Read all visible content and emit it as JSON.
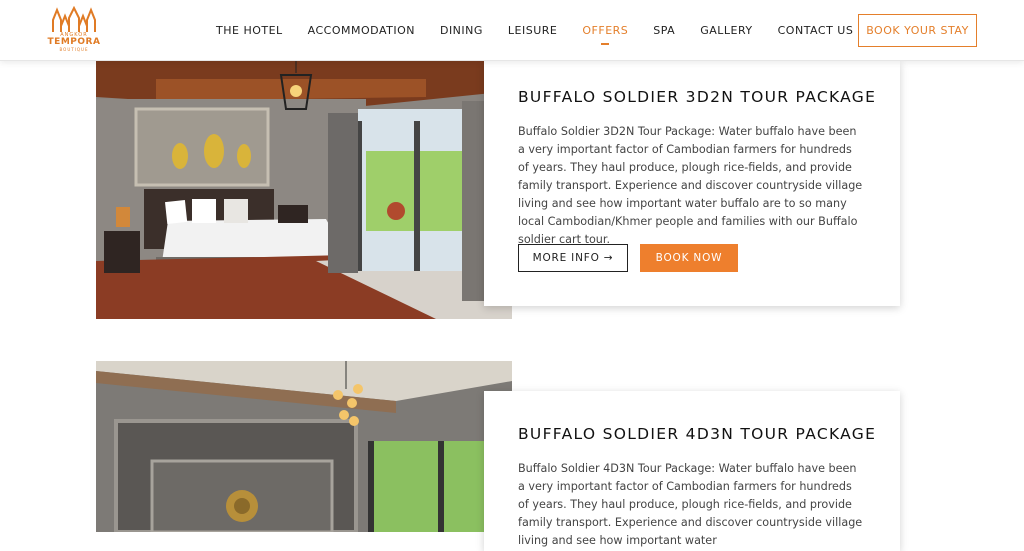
{
  "logo": {
    "top": "ANGKOR",
    "name": "TEMPORA",
    "sub": "BOUTIQUE"
  },
  "nav": {
    "items": [
      {
        "label": "THE HOTEL",
        "active": false
      },
      {
        "label": "ACCOMMODATION",
        "active": false
      },
      {
        "label": "DINING",
        "active": false
      },
      {
        "label": "LEISURE",
        "active": false
      },
      {
        "label": "OFFERS",
        "active": true
      },
      {
        "label": "SPA",
        "active": false
      },
      {
        "label": "GALLERY",
        "active": false
      },
      {
        "label": "CONTACT US",
        "active": false
      }
    ],
    "book_label": "BOOK YOUR STAY"
  },
  "colors": {
    "accent": "#e47f2b",
    "button": "#ee7f2d"
  },
  "packages": [
    {
      "title": "BUFFALO SOLDIER 3D2N TOUR PACKAGE",
      "description": "Buffalo Soldier 3D2N Tour Package: Water buffalo have been a very important factor of Cambodian farmers for hundreds of years. They haul produce, plough rice-fields, and provide family transport. Experience and discover countryside village living and see how important water buffalo are to so many local Cambodian/Khmer people and families with our Buffalo soldier cart tour.",
      "more_label": "MORE INFO →",
      "book_label": "BOOK NOW"
    },
    {
      "title": "BUFFALO SOLDIER 4D3N TOUR PACKAGE",
      "description": "Buffalo Soldier 4D3N Tour Package: Water buffalo have been a very important factor of Cambodian farmers for hundreds of years. They haul produce, plough rice-fields, and provide family transport. Experience and discover countryside village living and see how important water"
    }
  ]
}
